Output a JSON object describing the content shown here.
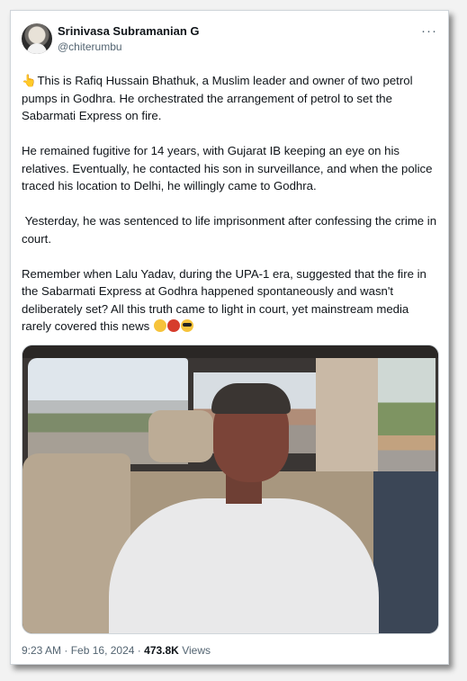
{
  "author": {
    "name": "Srinivasa Subramanian G",
    "handle": "@chiterumbu"
  },
  "more_label": "···",
  "tweet": {
    "hand_emoji": "👆",
    "paragraphs": [
      "This is Rafiq Hussain Bhathuk, a Muslim leader and owner of two petrol pumps in Godhra. He orchestrated the arrangement of petrol to set the Sabarmati Express on fire.",
      "He remained fugitive for 14 years, with Gujarat IB keeping an eye on his relatives. Eventually, he contacted his son in surveillance, and when the police traced his location to Delhi, he willingly came to Godhra.",
      " Yesterday, he was sentenced to life imprisonment after confessing the crime in court.",
      "Remember when Lalu Yadav, during the UPA-1 era, suggested that the fire in the Sabarmati Express at Godhra happened spontaneously and wasn't deliberately set? All this truth came to light in court, yet mainstream media rarely covered this news"
    ],
    "emojis": [
      "thinking-face",
      "angry-face",
      "sunglasses-face"
    ]
  },
  "footer": {
    "time": "9:23 AM",
    "separator": "·",
    "date": "Feb 16, 2024",
    "views_count": "473.8K",
    "views_label": "Views"
  },
  "colors": {
    "text": "#0f1419",
    "secondary": "#536471",
    "border": "#cfd4d9"
  }
}
